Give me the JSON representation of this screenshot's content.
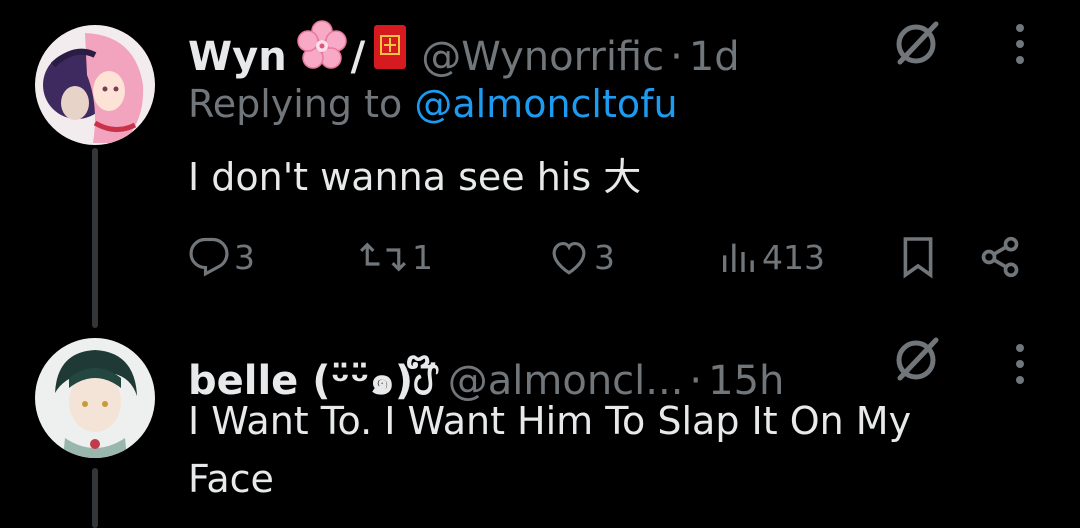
{
  "tweets": [
    {
      "name": "Wyn",
      "name_suffix": "/",
      "handle": "@Wynorrific",
      "separator": "·",
      "time": "1d",
      "replying_prefix": "Replying to",
      "replying_handle": "@almoncltofu",
      "text": "I don't wanna see his 大",
      "icons": [
        "cherry-blossom-emoji",
        "red-envelope-emoji",
        "grok-icon",
        "more-icon"
      ],
      "actions": {
        "replies": "3",
        "retweets": "1",
        "likes": "3",
        "views": "413"
      }
    },
    {
      "name": "belle (ᵕ̈ᵕ̈๑)ᦔ໊",
      "handle": "@almoncl...",
      "separator": "·",
      "time": "15h",
      "text_line1": "I Want To. I Want Him To Slap It On My",
      "text_line2": "Face",
      "icons": [
        "grok-icon",
        "more-icon"
      ]
    }
  ],
  "colors": {
    "background": "#000000",
    "text": "#e7e9ea",
    "muted": "#71767b",
    "link": "#1d9bf0",
    "thread_line": "#333639"
  }
}
